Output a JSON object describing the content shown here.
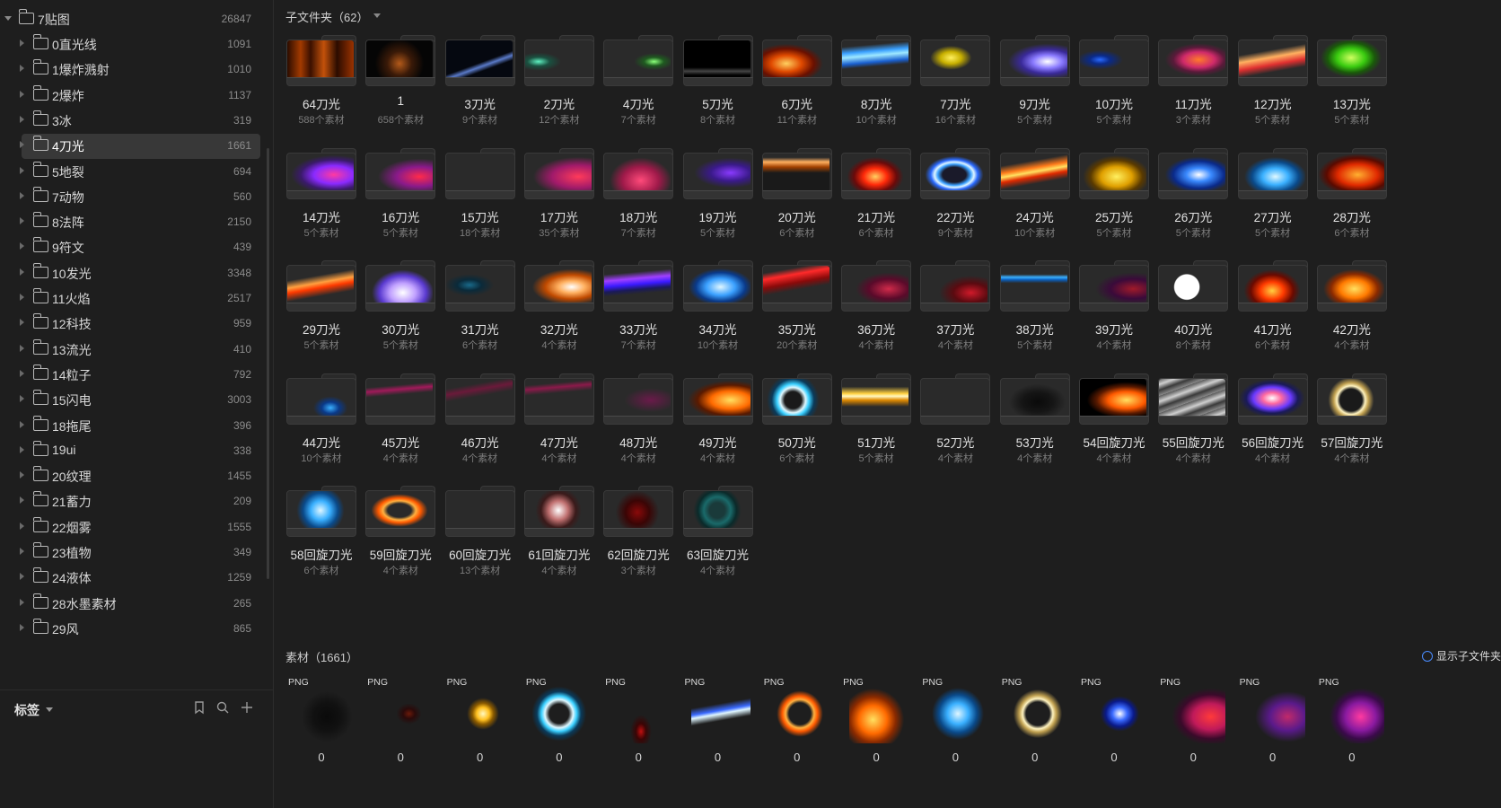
{
  "sidebar": {
    "root": {
      "label": "7贴图",
      "count": "26847"
    },
    "items": [
      {
        "label": "0直光线",
        "count": "1091"
      },
      {
        "label": "1爆炸溅射",
        "count": "1010"
      },
      {
        "label": "2爆炸",
        "count": "1137"
      },
      {
        "label": "3冰",
        "count": "319"
      },
      {
        "label": "4刀光",
        "count": "1661"
      },
      {
        "label": "5地裂",
        "count": "694"
      },
      {
        "label": "7动物",
        "count": "560"
      },
      {
        "label": "8法阵",
        "count": "2150"
      },
      {
        "label": "9符文",
        "count": "439"
      },
      {
        "label": "10发光",
        "count": "3348"
      },
      {
        "label": "11火焰",
        "count": "2517"
      },
      {
        "label": "12科技",
        "count": "959"
      },
      {
        "label": "13流光",
        "count": "410"
      },
      {
        "label": "14粒子",
        "count": "792"
      },
      {
        "label": "15闪电",
        "count": "3003"
      },
      {
        "label": "18拖尾",
        "count": "396"
      },
      {
        "label": "19ui",
        "count": "338"
      },
      {
        "label": "20纹理",
        "count": "1455"
      },
      {
        "label": "21蓄力",
        "count": "209"
      },
      {
        "label": "22烟雾",
        "count": "1555"
      },
      {
        "label": "23植物",
        "count": "349"
      },
      {
        "label": "24液体",
        "count": "1259"
      },
      {
        "label": "28水墨素材",
        "count": "265"
      },
      {
        "label": "29风",
        "count": "865"
      }
    ],
    "footer": {
      "tags_label": "标签"
    }
  },
  "subfolders": {
    "title": "子文件夹（62）",
    "items": [
      {
        "name": "64刀光",
        "sub": "588个素材",
        "bg": "linear-gradient(90deg,#2b0c00,#a33a00 20%,#3a1000 35%,#c2510a 55%,#2b0c00 75%,#9a3200)"
      },
      {
        "name": "1",
        "sub": "658个素材",
        "bg": "radial-gradient(circle at 50% 60%,#b35a1a 0%,#3a1a08 30%,#050505 60%)"
      },
      {
        "name": "3刀光",
        "sub": "9个素材",
        "bg": "linear-gradient(160deg,#050810 55%,#5a7ac8 62%,#050810 70%)"
      },
      {
        "name": "2刀光",
        "sub": "12个素材",
        "bg": "radial-gradient(ellipse at 20% 55%,#5ff0c0 0%,#1a5040 15%,#2a2a2a 30%)"
      },
      {
        "name": "4刀光",
        "sub": "7个素材",
        "bg": "radial-gradient(ellipse at 75% 55%,#8aff7a 0%,#1f5a20 14%,#2a2a2a 28%)"
      },
      {
        "name": "5刀光",
        "sub": "8个素材",
        "bg": "linear-gradient(180deg,#000 70%,#444 80%,#000 90%)"
      },
      {
        "name": "6刀光",
        "sub": "11个素材",
        "bg": "radial-gradient(ellipse at 35% 60%,#ffd060 0%,#e04a00 25%,#6a1000 45%,#2a2a2a 60%)"
      },
      {
        "name": "8刀光",
        "sub": "10个素材",
        "bg": "linear-gradient(175deg,#2a2a2a 15%,#3aa0ff 30%,#9ee8ff 40%,#1a60d0 55%,#2a2a2a 65%)"
      },
      {
        "name": "7刀光",
        "sub": "16个素材",
        "bg": "radial-gradient(ellipse at 45% 45%,#fff060 0%,#c8b000 20%,#2a2a2a 40%)"
      },
      {
        "name": "9刀光",
        "sub": "5个素材",
        "bg": "radial-gradient(ellipse at 70% 55%,#ffffff 0%,#8a7aff 22%,#3a2a9a 40%,#2a2a2a 60%)"
      },
      {
        "name": "10刀光",
        "sub": "5个素材",
        "bg": "radial-gradient(ellipse at 30% 50%,#2a6aff 0%,#0a2a8a 15%,#2a2a2a 35%)"
      },
      {
        "name": "11刀光",
        "sub": "3个素材",
        "bg": "radial-gradient(ellipse at 60% 50%,#ff7a2a 0%,#d02a6a 28%,#5a1a3a 45%,#2a2a2a 60%)"
      },
      {
        "name": "12刀光",
        "sub": "5个素材",
        "bg": "linear-gradient(170deg,#2a2a2a 30%,#ffb060 45%,#e03030 60%,#2a2a2a 75%)"
      },
      {
        "name": "13刀光",
        "sub": "5个素材",
        "bg": "radial-gradient(ellipse at 50% 45%,#d0ff60 0%,#3acc10 30%,#1a5a0a 50%,#2a2a2a 65%)"
      },
      {
        "name": "14刀光",
        "sub": "5个素材",
        "bg": "radial-gradient(ellipse at 70% 55%,#ff3aa0 0%,#8a2aff 30%,#3a1a6a 50%,#2a2a2a 65%)"
      },
      {
        "name": "16刀光",
        "sub": "5个素材",
        "bg": "radial-gradient(ellipse at 80% 60%,#ff2a4a 0%,#8a1a8a 30%,#2a2a2a 55%)"
      },
      {
        "name": "15刀光",
        "sub": "18个素材",
        "bg": "#2a2a2a"
      },
      {
        "name": "17刀光",
        "sub": "35个素材",
        "bg": "radial-gradient(ellipse at 80% 60%,#ff3a5a 0%,#a01a6a 35%,#2a2a2a 60%)"
      },
      {
        "name": "18刀光",
        "sub": "7个素材",
        "bg": "radial-gradient(ellipse at 55% 70%,#ff4a7a 0%,#a01a4a 35%,#2a2a2a 60%)"
      },
      {
        "name": "19刀光",
        "sub": "5个素材",
        "bg": "radial-gradient(ellipse at 70% 50%,#8a3aff 0%,#3a1a8a 30%,#2a2a2a 55%)"
      },
      {
        "name": "20刀光",
        "sub": "6个素材",
        "bg": "linear-gradient(180deg,#2a2a2a 10%,#ffb060 22%,#a04000 35%,#1a1a1a 50%)"
      },
      {
        "name": "21刀光",
        "sub": "6个素材",
        "bg": "radial-gradient(ellipse at 50% 60%,#ffd060 0%,#ff2a0a 25%,#6a0a0a 45%,#2a2a2a 60%)"
      },
      {
        "name": "22刀光",
        "sub": "9个素材",
        "bg": "radial-gradient(ellipse at 50% 55%,#1a1a2a 25%,#3aa0ff 35%,#dff6ff 42%,#2a6aff 50%,#2a2a2a 62%)"
      },
      {
        "name": "24刀光",
        "sub": "10个素材",
        "bg": "linear-gradient(170deg,#2a2a2a 25%,#ff7a1a 40%,#ffe060 48%,#e02a00 58%,#2a2a2a 72%)"
      },
      {
        "name": "25刀光",
        "sub": "5个素材",
        "bg": "radial-gradient(ellipse at 55% 60%,#fff060 0%,#e0a000 30%,#5a3a00 50%,#2a2a2a 65%)"
      },
      {
        "name": "26刀光",
        "sub": "5个素材",
        "bg": "radial-gradient(ellipse at 60% 55%,#ffffff 0%,#3a8aff 22%,#0a2a8a 45%,#2a2a2a 60%)"
      },
      {
        "name": "27刀光",
        "sub": "5个素材",
        "bg": "radial-gradient(ellipse at 55% 60%,#dff8ff 0%,#3ab0ff 25%,#0a4a8a 45%,#2a2a2a 60%)"
      },
      {
        "name": "28刀光",
        "sub": "6个素材",
        "bg": "radial-gradient(ellipse at 60% 55%,#ffb030 0%,#e02a00 35%,#5a0a00 55%,#2a2a2a 70%)"
      },
      {
        "name": "29刀光",
        "sub": "5个素材",
        "bg": "linear-gradient(170deg,#2a2a2a 30%,#ffa040 45%,#ff3a00 55%,#2a2a2a 72%)"
      },
      {
        "name": "30刀光",
        "sub": "5个素材",
        "bg": "radial-gradient(ellipse at 55% 70%,#ffffff 0%,#c0a0ff 25%,#5a3ad0 45%,#2a2a2a 60%)"
      },
      {
        "name": "31刀光",
        "sub": "6个素材",
        "bg": "radial-gradient(ellipse at 35% 50%,#1a6a8a 0%,#0a2a3a 20%,#2a2a2a 40%)"
      },
      {
        "name": "32刀光",
        "sub": "4个素材",
        "bg": "radial-gradient(ellipse at 70% 55%,#ffffff 0%,#ffb060 20%,#c04a00 40%,#2a2a2a 60%)"
      },
      {
        "name": "33刀光",
        "sub": "7个素材",
        "bg": "linear-gradient(175deg,#2a2a2a 20%,#a040ff 35%,#3a1aff 48%,#1a1a5a 60%,#2a2a2a 70%)"
      },
      {
        "name": "34刀光",
        "sub": "10个素材",
        "bg": "radial-gradient(ellipse at 55% 55%,#dff6ff 0%,#3aa0ff 28%,#0a3a8a 48%,#2a2a2a 62%)"
      },
      {
        "name": "35刀光",
        "sub": "20个素材",
        "bg": "linear-gradient(170deg,#2a2a2a 15%,#ff2a2a 28%,#8a0a0a 45%,#2a2a2a 60%)"
      },
      {
        "name": "36刀光",
        "sub": "4个素材",
        "bg": "radial-gradient(ellipse at 70% 60%,#d02a4a 0%,#5a0a2a 30%,#2a2a2a 50%)"
      },
      {
        "name": "37刀光",
        "sub": "4个素材",
        "bg": "radial-gradient(ellipse at 75% 70%,#d01a2a 0%,#5a0a10 25%,#2a2a2a 45%)"
      },
      {
        "name": "38刀光",
        "sub": "5个素材",
        "bg": "linear-gradient(180deg,#2a2a2a 22%,#3ab0ff 30%,#0a60c0 36%,#2a2a2a 45%)"
      },
      {
        "name": "39刀光",
        "sub": "4个素材",
        "bg": "radial-gradient(ellipse at 80% 60%,#a01a2a 0%,#3a0a3a 30%,#2a2a2a 50%)"
      },
      {
        "name": "40刀光",
        "sub": "8个素材",
        "bg": "radial-gradient(circle at 42% 55%,#ffffff 0%,#ffffff 28%,#2a2a2a 30%)"
      },
      {
        "name": "41刀光",
        "sub": "6个素材",
        "bg": "radial-gradient(ellipse at 50% 65%,#ffd040 0%,#ff3a00 25%,#6a0a00 45%,#2a2a2a 60%)"
      },
      {
        "name": "42刀光",
        "sub": "4个素材",
        "bg": "radial-gradient(ellipse at 55% 60%,#ffe060 0%,#ff7a00 28%,#8a2a00 45%,#2a2a2a 60%)"
      },
      {
        "name": "44刀光",
        "sub": "10个素材",
        "bg": "radial-gradient(ellipse at 65% 75%,#3ab0ff 0%,#0a3a8a 14%,#2a2a2a 28%)"
      },
      {
        "name": "45刀光",
        "sub": "4个素材",
        "bg": "linear-gradient(175deg,#2a2a2a 20%,#a01a5a 30%,#2a2a2a 42%)"
      },
      {
        "name": "46刀光",
        "sub": "4个素材",
        "bg": "linear-gradient(170deg,#2a2a2a 20%,#6a1a3a 32%,#2a2a2a 46%)"
      },
      {
        "name": "47刀光",
        "sub": "4个素材",
        "bg": "linear-gradient(175deg,#2a2a2a 15%,#8a1a4a 25%,#2a2a2a 38%)"
      },
      {
        "name": "48刀光",
        "sub": "4个素材",
        "bg": "radial-gradient(ellipse at 70% 55%,#6a1a4a 0%,#2a2a2a 40%)"
      },
      {
        "name": "49刀光",
        "sub": "4个素材",
        "bg": "radial-gradient(ellipse at 70% 55%,#ffe060 0%,#ff6a00 30%,#5a1a00 50%,#2a2a2a 65%)"
      },
      {
        "name": "50刀光",
        "sub": "6个素材",
        "bg": "radial-gradient(circle at 45% 55%,#1a1a1a 20%,#dff8ff 30%,#3ad0ff 38%,#0a3a5a 50%,#2a2a2a 62%)"
      },
      {
        "name": "51刀光",
        "sub": "5个素材",
        "bg": "linear-gradient(180deg,#2a2a2a 20%,#ffd040 38%,#fff8c0 45%,#e08a00 55%,#2a2a2a 72%)"
      },
      {
        "name": "52刀光",
        "sub": "4个素材",
        "bg": "#2a2a2a"
      },
      {
        "name": "53刀光",
        "sub": "4个素材",
        "bg": "radial-gradient(ellipse at 55% 60%,#0a0a0a 0%,#151515 30%,#2a2a2a 55%)"
      },
      {
        "name": "54回旋刀光",
        "sub": "4个素材",
        "bg": "radial-gradient(ellipse at 70% 55%,#ffe060 0%,#ff5a00 28%,#5a1a00 45%,#000 60%)"
      },
      {
        "name": "55回旋刀光",
        "sub": "4个素材",
        "bg": "repeating-linear-gradient(160deg,#5a5a5a 0px,#cfcfcf 6px,#3a3a3a 12px,#8a8a8a 18px)"
      },
      {
        "name": "56回旋刀光",
        "sub": "4个素材",
        "bg": "radial-gradient(ellipse at 50% 50%,#ffffff 0%,#ff6aa0 20%,#6a3aff 40%,#1a1a5a 55%,#2a2a2a 70%)"
      },
      {
        "name": "57回旋刀光",
        "sub": "4个素材",
        "bg": "radial-gradient(circle at 50% 55%,#1a1a1a 28%,#fff3c0 36%,#c0a050 44%,#2a2a2a 58%)"
      },
      {
        "name": "58回旋刀光",
        "sub": "6个素材",
        "bg": "radial-gradient(circle at 50% 50%,#dff6ff 0%,#3ab0ff 25%,#0a4a8a 45%,#2a2a2a 62%)"
      },
      {
        "name": "59回旋刀光",
        "sub": "4个素材",
        "bg": "radial-gradient(ellipse at 50% 50%,#2a2a2a 25%,#ffb040 35%,#ff5a00 45%,#2a2a2a 60%)"
      },
      {
        "name": "60回旋刀光",
        "sub": "13个素材",
        "bg": "#2a2a2a"
      },
      {
        "name": "61回旋刀光",
        "sub": "4个素材",
        "bg": "radial-gradient(circle at 50% 50%,#ffffff 0%,#c07070 25%,#3a1a1a 45%,#2a2a2a 60%)"
      },
      {
        "name": "62回旋刀光",
        "sub": "3个素材",
        "bg": "radial-gradient(circle at 50% 55%,#8a0a0a 0%,#3a0505 30%,#2a2a2a 55%)"
      },
      {
        "name": "63回旋刀光",
        "sub": "4个素材",
        "bg": "radial-gradient(circle at 50% 50%,#1a3a3a 20%,#1a6a6a 35%,#0a2a2a 50%,#2a2a2a 62%)"
      }
    ]
  },
  "assets": {
    "title": "素材（1661）",
    "show_subfolder_label": "显示子文件夹",
    "items": [
      {
        "type": "PNG",
        "count": "0",
        "bg": "radial-gradient(ellipse at 55% 55%,#0a0a0a 0%,#111 30%,#1e1e1e 55%)"
      },
      {
        "type": "PNG",
        "count": "0",
        "bg": "radial-gradient(ellipse at 60% 50%,#6a1a0a 0%,#2a0a0a 12%,#1e1e1e 25%)"
      },
      {
        "type": "PNG",
        "count": "0",
        "bg": "radial-gradient(ellipse at 50% 50%,#fff8c0 0%,#ffc020 15%,#8a5a00 25%,#1e1e1e 38%)"
      },
      {
        "type": "PNG",
        "count": "0",
        "bg": "radial-gradient(circle at 45% 50%,#1e1e1e 22%,#dff8ff 32%,#3ad0ff 40%,#0a3a5a 50%,#1e1e1e 62%)"
      },
      {
        "type": "PNG",
        "count": "0",
        "bg": "radial-gradient(ellipse at 50% 80%,#c01010 0%,#3a0505 12%,#1e1e1e 25%)"
      },
      {
        "type": "PNG",
        "count": "0",
        "bg": "linear-gradient(170deg,#1e1e1e 35%,#3a6aff 45%,#dff6ff 50%,#1e1e1e 60%)"
      },
      {
        "type": "PNG",
        "count": "0",
        "bg": "radial-gradient(ellipse at 50% 50%,#1e1e1e 26%,#ffb040 34%,#ff5a00 42%,#1e1e1e 55%)"
      },
      {
        "type": "PNG",
        "count": "0",
        "bg": "radial-gradient(ellipse at 40% 60%,#ffe060 0%,#ff6a00 28%,#8a2a00 45%,#1e1e1e 62%)"
      },
      {
        "type": "PNG",
        "count": "0",
        "bg": "radial-gradient(circle at 50% 50%,#dff6ff 0%,#3ab0ff 25%,#0a4a8a 45%,#1e1e1e 62%)"
      },
      {
        "type": "PNG",
        "count": "0",
        "bg": "radial-gradient(circle at 50% 50%,#1e1e1e 28%,#fff3c0 36%,#c0a050 44%,#1e1e1e 58%)"
      },
      {
        "type": "PNG",
        "count": "0",
        "bg": "radial-gradient(ellipse at 55% 50%,#ffffff 0%,#3a6aff 16%,#0a1a8a 30%,#1e1e1e 42%)"
      },
      {
        "type": "PNG",
        "count": "0",
        "bg": "radial-gradient(ellipse at 75% 55%,#ff3a3a 0%,#c01a5a 28%,#3a0a2a 48%,#1e1e1e 62%)"
      },
      {
        "type": "PNG",
        "count": "0",
        "bg": "radial-gradient(ellipse at 70% 55%,#c02a6a 0%,#5a1a8a 30%,#1e1e1e 55%)"
      },
      {
        "type": "PNG",
        "count": "0",
        "bg": "radial-gradient(ellipse at 60% 55%,#ff3aa0 0%,#8a1aa0 30%,#3a0a4a 48%,#1e1e1e 62%)"
      }
    ]
  },
  "colors": {
    "background": "#1e1e1e",
    "accent": "#4a8cff",
    "selected": "#383838"
  }
}
